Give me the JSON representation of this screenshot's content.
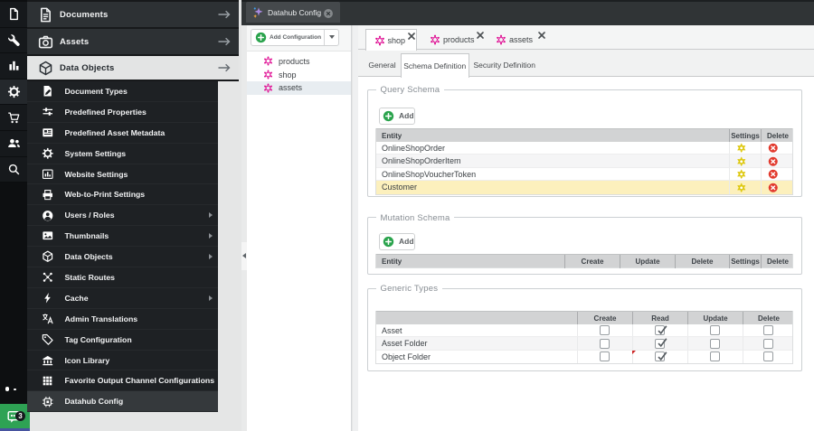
{
  "icon_strip": {
    "icons": [
      {
        "name": "file-icon"
      },
      {
        "name": "wrench-icon"
      },
      {
        "name": "bar-chart-icon"
      },
      {
        "name": "gear-icon",
        "active": true
      },
      {
        "name": "cart-icon"
      },
      {
        "name": "users-icon"
      },
      {
        "name": "search-icon"
      }
    ],
    "support_badge_count": "3"
  },
  "main_menu": {
    "items": [
      {
        "label": "Documents",
        "icon": "document-icon"
      },
      {
        "label": "Assets",
        "icon": "camera-icon"
      },
      {
        "label": "Data Objects",
        "icon": "cube-icon",
        "active": true
      }
    ]
  },
  "settings_menu": {
    "items": [
      {
        "label": "Document Types",
        "icon": "document-types-icon"
      },
      {
        "label": "Predefined Properties",
        "icon": "sliders-icon"
      },
      {
        "label": "Predefined Asset Metadata",
        "icon": "asset-metadata-icon"
      },
      {
        "label": "System Settings",
        "icon": "gear-icon"
      },
      {
        "label": "Website Settings",
        "icon": "website-settings-icon"
      },
      {
        "label": "Web-to-Print Settings",
        "icon": "printer-icon"
      },
      {
        "label": "Users / Roles",
        "icon": "user-circle-icon",
        "arrow": true
      },
      {
        "label": "Thumbnails",
        "icon": "photo-icon",
        "arrow": true
      },
      {
        "label": "Data Objects",
        "icon": "cube-icon",
        "arrow": true
      },
      {
        "label": "Static Routes",
        "icon": "routes-icon"
      },
      {
        "label": "Cache",
        "icon": "bolt-icon",
        "arrow": true
      },
      {
        "label": "Admin Translations",
        "icon": "translate-icon"
      },
      {
        "label": "Tag Configuration",
        "icon": "tag-icon"
      },
      {
        "label": "Icon Library",
        "icon": "bank-icon"
      },
      {
        "label": "Favorite Output Channel Configurations",
        "icon": "grid-icon"
      },
      {
        "label": "Datahub Config",
        "icon": "chip-icon",
        "active": true
      }
    ]
  },
  "window": {
    "tab_label": "Datahub Config",
    "tab_icon": "sparkle-icon"
  },
  "tree": {
    "add_button_label": "Add Configuration",
    "items": [
      {
        "label": "products",
        "icon": "graphql-icon"
      },
      {
        "label": "shop",
        "icon": "graphql-icon"
      },
      {
        "label": "assets",
        "icon": "graphql-icon",
        "selected": true
      }
    ]
  },
  "tabs": [
    {
      "label": "shop",
      "icon": "graphql-icon",
      "active": true
    },
    {
      "label": "products",
      "icon": "graphql-icon"
    },
    {
      "label": "assets",
      "icon": "graphql-icon"
    }
  ],
  "subtabs": [
    {
      "label": "General"
    },
    {
      "label": "Schema Definition",
      "active": true
    },
    {
      "label": "Security Definition"
    }
  ],
  "query_schema": {
    "legend": "Query Schema",
    "add_button_label": "Add",
    "columns": [
      "Entity",
      "Settings",
      "Delete"
    ],
    "rows": [
      {
        "entity": "OnlineShopOrder"
      },
      {
        "entity": "OnlineShopOrderItem"
      },
      {
        "entity": "OnlineShopVoucherToken"
      },
      {
        "entity": "Customer",
        "highlighted": true
      }
    ]
  },
  "mutation_schema": {
    "legend": "Mutation Schema",
    "add_button_label": "Add",
    "columns": [
      "Entity",
      "Create",
      "Update",
      "Delete",
      "Settings",
      "Delete"
    ],
    "rows": []
  },
  "generic_types": {
    "legend": "Generic Types",
    "columns": [
      "",
      "Create",
      "Read",
      "Update",
      "Delete"
    ],
    "rows": [
      {
        "label": "Asset",
        "create": false,
        "read": true,
        "update": false,
        "delete": false
      },
      {
        "label": "Asset Folder",
        "create": false,
        "read": true,
        "update": false,
        "delete": false
      },
      {
        "label": "Object Folder",
        "create": false,
        "read": true,
        "update": false,
        "delete": false,
        "dirty": true
      }
    ]
  },
  "colors": {
    "accent_green": "#2aa34c",
    "graphql_pink": "#df0b92",
    "gear_yellow": "#ddc70a",
    "delete_red": "#e23a2e",
    "highlight_yellow": "#fcf0bd",
    "menu_dark": "#1e2124",
    "bar_dark": "#303436"
  }
}
